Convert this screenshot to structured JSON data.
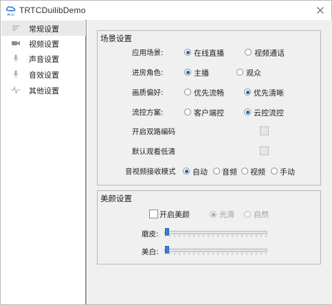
{
  "window": {
    "title": "TRTCDuilibDemo"
  },
  "logo": {
    "caption": "腾讯云"
  },
  "sidebar": {
    "items": [
      {
        "label": "常规设置",
        "icon": "list-icon",
        "active": true
      },
      {
        "label": "视频设置",
        "icon": "video-camera-icon",
        "active": false
      },
      {
        "label": "声音设置",
        "icon": "microphone-icon",
        "active": false
      },
      {
        "label": "音效设置",
        "icon": "microphone-icon",
        "active": false
      },
      {
        "label": "其他设置",
        "icon": "pulse-icon",
        "active": false
      }
    ]
  },
  "scene": {
    "title": "场景设置",
    "app_scene": {
      "label": "应用场景:",
      "options": [
        "在线直播",
        "视频通话"
      ],
      "selected": 0
    },
    "role": {
      "label": "进房角色:",
      "options": [
        "主播",
        "观众"
      ],
      "selected": 0
    },
    "quality": {
      "label": "画质偏好:",
      "options": [
        "优先流畅",
        "优先清晰"
      ],
      "selected": 1
    },
    "flow_control": {
      "label": "流控方案:",
      "options": [
        "客户端控",
        "云控流控"
      ],
      "selected": 1
    },
    "dual_stream": {
      "label": "开启双路编码",
      "checked": false
    },
    "default_low": {
      "label": "默认观看低清",
      "checked": false
    },
    "receive_mode": {
      "label": "音视频接收模式",
      "options": [
        "自动",
        "音频",
        "视频",
        "手动"
      ],
      "selected": 0
    }
  },
  "beauty": {
    "title": "美颜设置",
    "enable": {
      "label": "开启美颜",
      "checked": false
    },
    "style": {
      "options": [
        "光滑",
        "自然"
      ],
      "selected": 0
    },
    "smooth": {
      "label": "磨皮:",
      "value": 0
    },
    "whiten": {
      "label": "美白:",
      "value": 0
    }
  },
  "colors": {
    "accent": "#1f5fae",
    "slider": "#3a7dd6",
    "sidebar_active": "#e9e9e9",
    "panel": "#f0f0f0"
  }
}
